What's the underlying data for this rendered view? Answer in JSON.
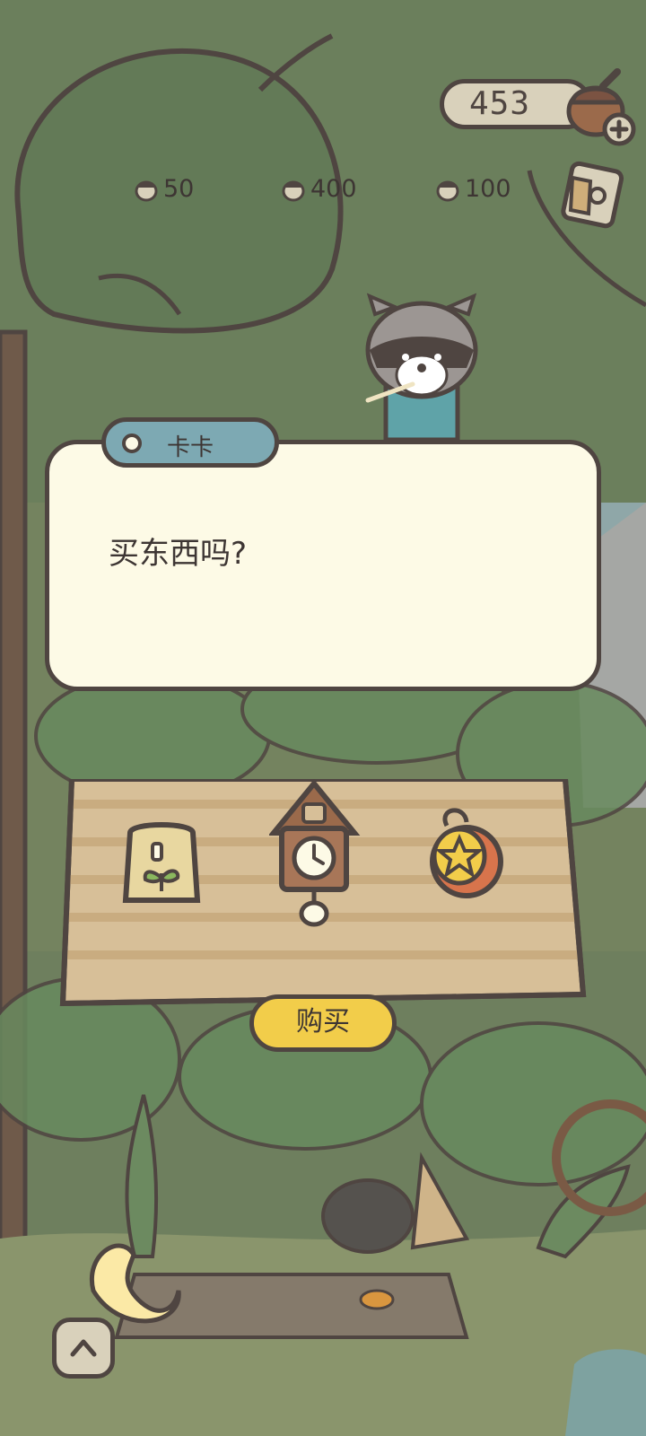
{
  "hud": {
    "acorn_count": "453",
    "acorn_icon": "acorn-plus-icon",
    "cup_icon": "mug-icon"
  },
  "dialog": {
    "speaker": "卡卡",
    "message": "买东西吗?"
  },
  "shop": {
    "items": [
      {
        "icon": "seed-bag-icon",
        "price": "50"
      },
      {
        "icon": "cuckoo-clock-icon",
        "price": "400"
      },
      {
        "icon": "star-yoyo-icon",
        "price": "100"
      }
    ],
    "buy_label": "购买"
  },
  "controls": {
    "expand_icon": "chevron-up-icon"
  },
  "colors": {
    "outline": "#4f4541",
    "dialog_bg": "#fdfae6",
    "name_tag": "#7da9b3",
    "buy_button": "#f2cd4a",
    "board": "#d7bf98"
  }
}
